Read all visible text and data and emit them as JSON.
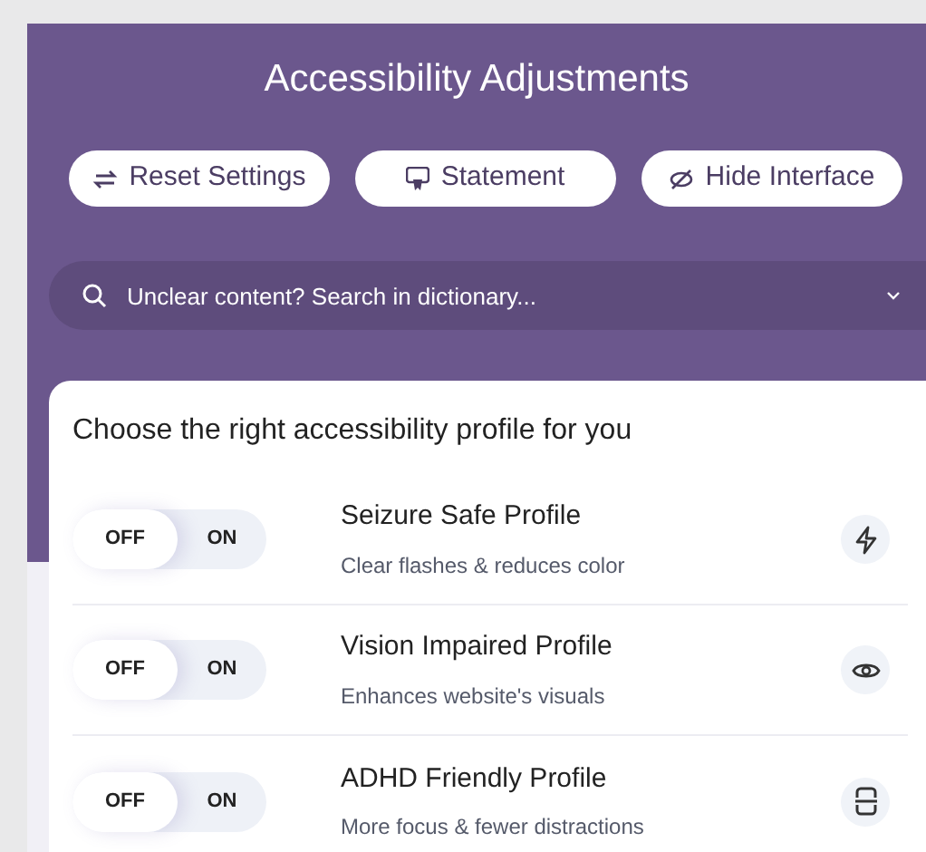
{
  "title": "Accessibility Adjustments",
  "buttons": [
    {
      "kind": "reset",
      "label": "Reset Settings"
    },
    {
      "kind": "statement",
      "label": "Statement"
    },
    {
      "kind": "hide",
      "label": "Hide Interface"
    }
  ],
  "search": {
    "placeholder": "Unclear content? Search in dictionary..."
  },
  "profiles_heading": "Choose the right accessibility profile for you",
  "profiles": [
    {
      "kind": "seizure",
      "name": "Seizure Safe Profile",
      "description": "Clear flashes & reduces color",
      "on": false,
      "off_label": "OFF",
      "on_label": "ON"
    },
    {
      "kind": "vision",
      "name": "Vision Impaired Profile",
      "description": "Enhances website's visuals",
      "on": false,
      "off_label": "OFF",
      "on_label": "ON"
    },
    {
      "kind": "adhd",
      "name": "ADHD Friendly Profile",
      "description": "More focus & fewer distractions",
      "on": false,
      "off_label": "OFF",
      "on_label": "ON"
    }
  ]
}
